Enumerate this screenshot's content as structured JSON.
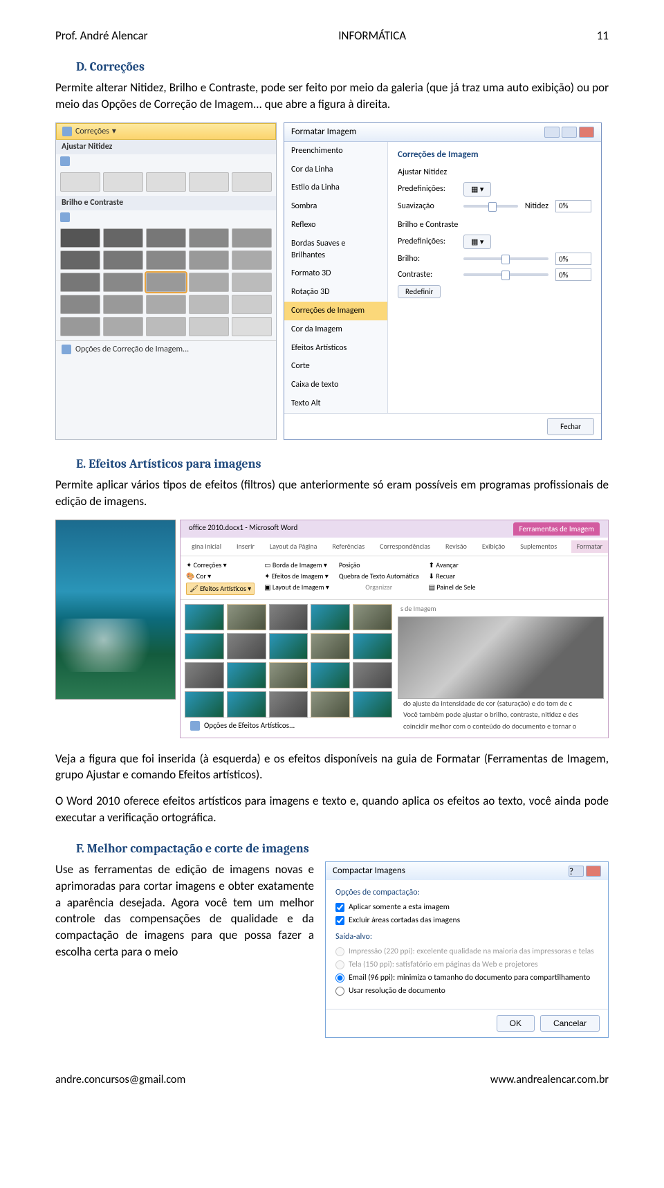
{
  "header": {
    "author": "Prof. André Alencar",
    "subject": "INFORMÁTICA",
    "page": "11"
  },
  "sections": {
    "d": {
      "letter": "D.",
      "title": "Correções",
      "para": "Permite alterar Nitidez, Brilho e Contraste, pode ser feito por meio da galeria (que já traz uma auto exibição) ou por meio das Opções de Correção de Imagem... que abre a figura à direita."
    },
    "e": {
      "letter": "E.",
      "title": "Efeitos Artísticos para imagens",
      "para": "Permite aplicar vários tipos de efeitos (filtros) que anteriormente só eram possíveis em programas profissionais de edição de imagens.",
      "para2": "Veja a figura que foi inserida (à esquerda) e os efeitos disponíveis na guia de Formatar (Ferramentas de Imagem, grupo Ajustar e comando Efeitos artísticos).",
      "para3": "O Word 2010 oferece efeitos artísticos para imagens e texto e, quando aplica os efeitos ao texto, você ainda pode executar a verificação ortográfica."
    },
    "f": {
      "letter": "F.",
      "title": "Melhor compactação e corte de imagens",
      "para": "Use as ferramentas de edição de imagens novas e aprimoradas para cortar imagens e obter exatamente a aparência desejada. Agora você tem um melhor controle das compensações de qualidade e da compactação de imagens para que possa fazer a escolha certa para o meio"
    }
  },
  "gallery_corr": {
    "button": "Correções",
    "sec1": "Ajustar Nitidez",
    "sec2": "Brilho e Contraste",
    "footer": "Opções de Correção de Imagem..."
  },
  "dialog_fmt": {
    "title": "Formatar Imagem",
    "nav": [
      "Preenchimento",
      "Cor da Linha",
      "Estilo da Linha",
      "Sombra",
      "Reflexo",
      "Bordas Suaves e Brilhantes",
      "Formato 3D",
      "Rotação 3D",
      "Correções de Imagem",
      "Cor da Imagem",
      "Efeitos Artísticos",
      "Corte",
      "Caixa de texto",
      "Texto Alt"
    ],
    "active_index": 8,
    "main_title": "Correções de Imagem",
    "sharp_sec": "Ajustar Nitidez",
    "presets": "Predefinições:",
    "soft_lbl": "Suavização",
    "nit_lbl": "Nitidez",
    "nit_val": "0%",
    "bc_sec": "Brilho e Contraste",
    "bri_lbl": "Brilho:",
    "bri_val": "0%",
    "con_lbl": "Contraste:",
    "con_val": "0%",
    "redefine": "Redefinir",
    "close": "Fechar"
  },
  "artistic": {
    "doc_title": "office 2010.docx1 - Microsoft Word",
    "tool_tab": "Ferramentas de Imagem",
    "tool_sub": "Formatar",
    "ribbon_tabs": [
      "gina Inicial",
      "Inserir",
      "Layout da Página",
      "Referências",
      "Correspondências",
      "Revisão",
      "Exibição",
      "Suplementos"
    ],
    "cmd_correcoes": "Correções",
    "cmd_cor": "Cor",
    "cmd_efeitos": "Efeitos Artísticos",
    "cmd_borda": "Borda de Imagem",
    "cmd_efeitos2": "Efeitos de Imagem",
    "cmd_layout": "Layout de Imagem",
    "cmd_posicao": "Posição",
    "cmd_quebra": "Quebra de Texto Automática",
    "cmd_avancar": "Avançar",
    "cmd_recuar": "Recuar",
    "cmd_painel": "Painel de Sele",
    "cmd_org": "Organizar",
    "gallery_footer": "Opções de Efeitos Artísticos...",
    "section_label": "s de Imagem",
    "desc1": "do ajuste da intensidade de cor (saturação) e do tom de c",
    "desc2": "Você também pode ajustar o brilho, contraste, nitidez e des",
    "desc3": "coincidir melhor com o conteúdo do documento e tornar o"
  },
  "compact": {
    "title": "Compactar Imagens",
    "grp1": "Opções de compactação:",
    "chk1": "Aplicar somente a esta imagem",
    "chk2": "Excluir áreas cortadas das imagens",
    "grp2": "Saída-alvo:",
    "r1": "Impressão (220 ppi): excelente qualidade na maioria das impressoras e telas",
    "r2": "Tela (150 ppi): satisfatório em páginas da Web e projetores",
    "r3": "Email (96 ppi): minimiza o tamanho do documento para compartilhamento",
    "r4": "Usar resolução de documento",
    "ok": "OK",
    "cancel": "Cancelar"
  },
  "footer": {
    "email": "andre.concursos@gmail.com",
    "site": "www.andrealencar.com.br"
  }
}
